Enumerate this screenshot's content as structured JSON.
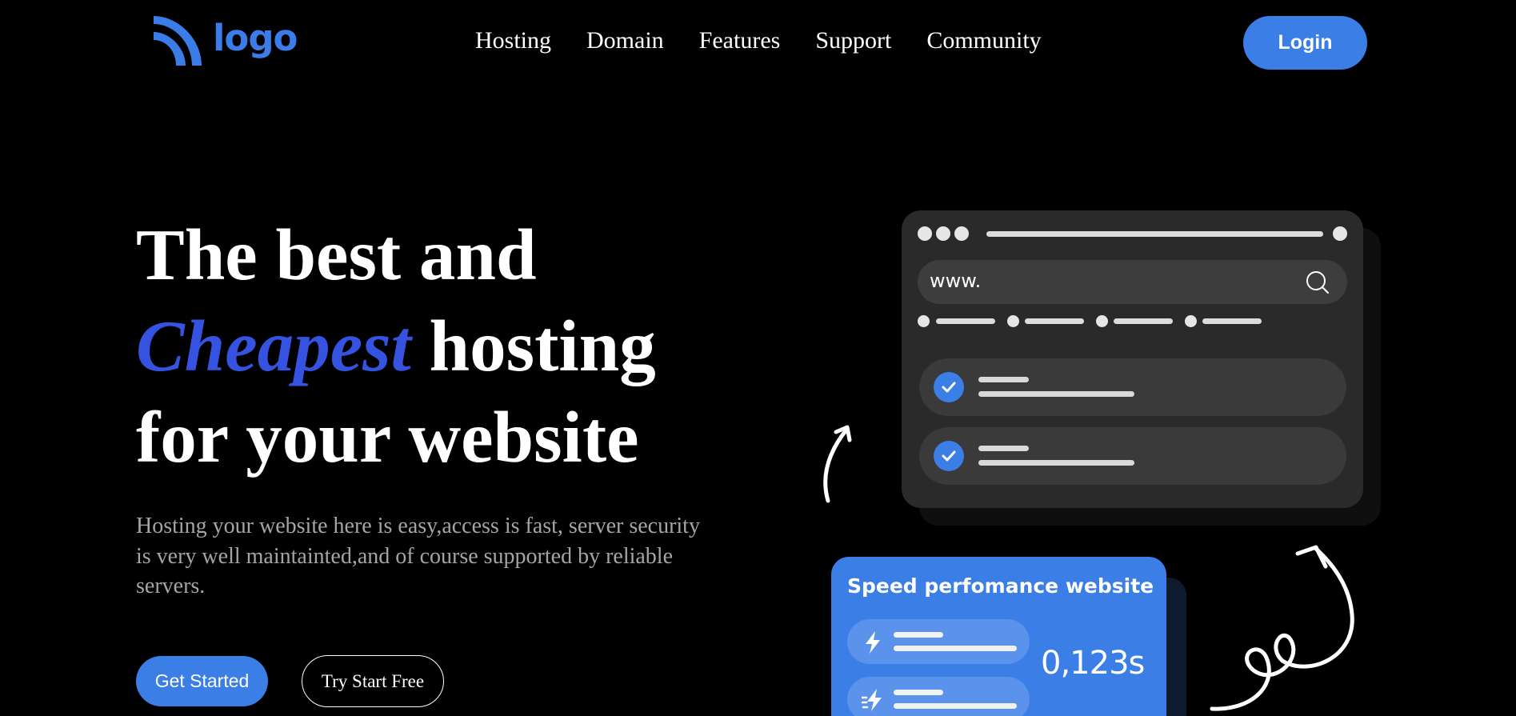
{
  "logo": {
    "text": "logo",
    "icon": "wifi-signal-icon",
    "color": "#3a7de8"
  },
  "nav": {
    "items": [
      "Hosting",
      "Domain",
      "Features",
      "Support",
      "Community"
    ]
  },
  "header": {
    "login_label": "Login"
  },
  "hero": {
    "title_line1": "The best and",
    "title_accent": "Cheapest",
    "title_line2_rest": " hosting",
    "title_line3": "for your website",
    "description": "Hosting your website here is easy,access is fast, server security is very well maintainted,and of course supported by reliable servers.",
    "primary_cta": "Get Started",
    "secondary_cta": "Try Start Free"
  },
  "browser_mock": {
    "url_text": "www.",
    "search_icon": "search-icon",
    "check_icon": "check-icon"
  },
  "speed_card": {
    "title": "Speed perfomance website",
    "value": "0,123s",
    "icons": [
      "lightning-icon",
      "fast-lightning-icon"
    ]
  },
  "colors": {
    "accent": "#3b7ee6",
    "accent_title": "#3553e0",
    "background": "#000000",
    "card_dark": "#2a2a2a"
  }
}
